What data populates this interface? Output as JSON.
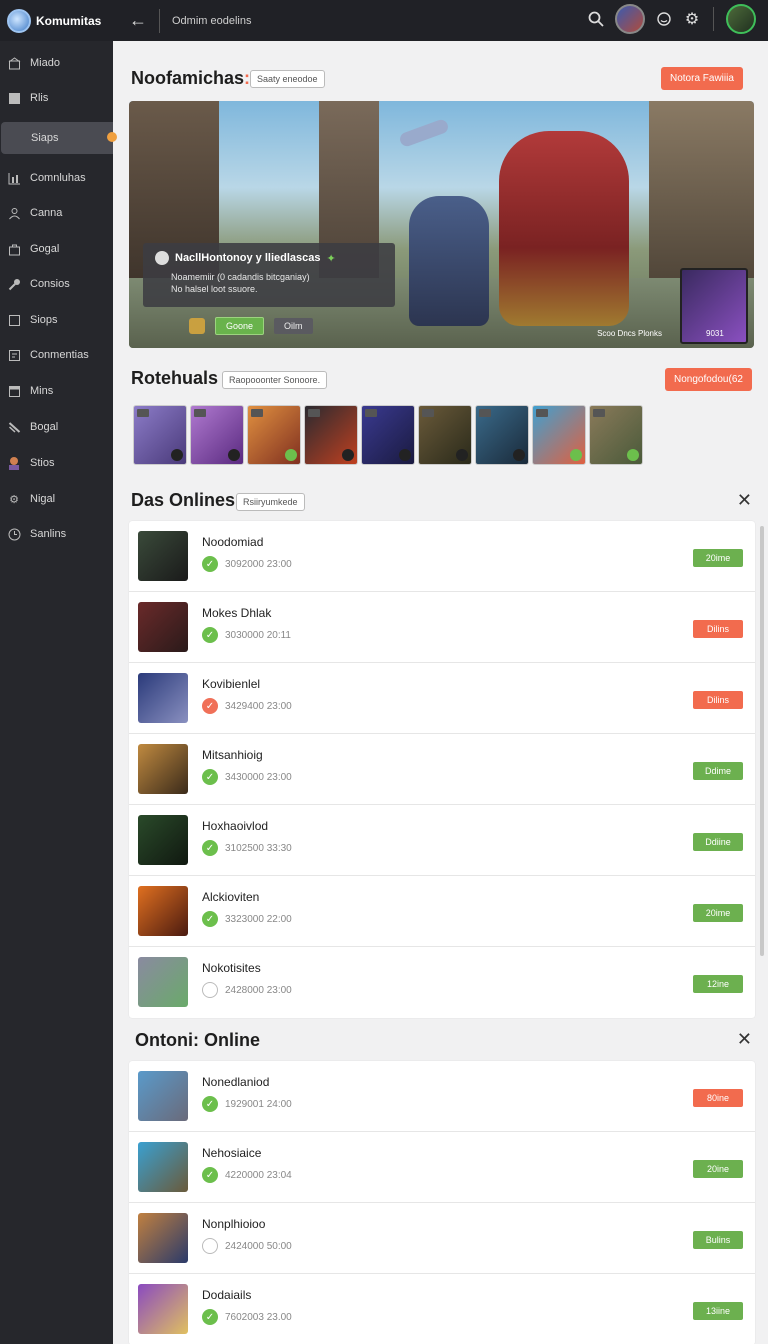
{
  "app": {
    "name": "Komumitas",
    "breadcrumb": "Odmim eodelins"
  },
  "sidebar": {
    "items": [
      {
        "label": "Miado",
        "icon": "home-icon"
      },
      {
        "label": "Rlis",
        "icon": "box-icon"
      },
      {
        "label": "Siaps",
        "icon": "flag-icon",
        "active": true
      },
      {
        "label": "Comnluhas",
        "icon": "chart-icon"
      },
      {
        "label": "Canna",
        "icon": "people-icon"
      },
      {
        "label": "Gogal",
        "icon": "bag-icon"
      },
      {
        "label": "Consios",
        "icon": "key-icon"
      },
      {
        "label": "Siops",
        "icon": "square-icon"
      },
      {
        "label": "Conmentias",
        "icon": "note-icon"
      },
      {
        "label": "Mins",
        "icon": "window-icon"
      },
      {
        "label": "Bogal",
        "icon": "tools-icon"
      },
      {
        "label": "Stios",
        "icon": "avatar-icon"
      },
      {
        "label": "Nigal",
        "icon": "gear-icon"
      },
      {
        "label": "Sanlins",
        "icon": "clock-icon"
      }
    ]
  },
  "featured": {
    "title": "Noofamichas",
    "chip": "Saaty eneodoe",
    "cta": "Notora Fawiiia",
    "hero": {
      "card_title": "NacllHontonoy y lliedlascas",
      "card_sub_1": "Noamemiir (0 cadandis bitcganiay)",
      "card_sub_2": "No halsel loot ssuore.",
      "btn_primary": "Goone",
      "btn_secondary": "Oilm",
      "caption": "Scoo Dncs Plonks",
      "thumb_label": "9031"
    }
  },
  "rotations": {
    "title": "Rotehuals",
    "chip": "Raopooonter Sonoore.",
    "cta": "Nongofodou(62",
    "thumbs": [
      {
        "colors": [
          "#8c7cc8",
          "#4a3a7a"
        ],
        "check": "dark"
      },
      {
        "colors": [
          "#b07ad0",
          "#5a2a80"
        ],
        "check": "dark"
      },
      {
        "colors": [
          "#e09040",
          "#803020"
        ],
        "check": "green"
      },
      {
        "colors": [
          "#2a2a30",
          "#c04020"
        ],
        "check": "dark"
      },
      {
        "colors": [
          "#3a3a90",
          "#1a1a40"
        ],
        "check": "dark"
      },
      {
        "colors": [
          "#6a5a3a",
          "#2a2a1a"
        ],
        "check": "dark"
      },
      {
        "colors": [
          "#3a6a8a",
          "#1a2a3a"
        ],
        "check": "dark"
      },
      {
        "colors": [
          "#40a0d0",
          "#e06040"
        ],
        "check": "green"
      },
      {
        "colors": [
          "#8a7a5a",
          "#4a5a3a"
        ],
        "check": "green"
      }
    ]
  },
  "das_onlines": {
    "title": "Das Onlines",
    "chip": "Rsiiryumkede",
    "rows": [
      {
        "name": "Noodomiad",
        "time": "3092000 23:00",
        "check": "green",
        "status": "20ime",
        "pill": "green",
        "avatar": [
          "#3a4a3a",
          "#1a1a1a"
        ]
      },
      {
        "name": "Mokes Dhlak",
        "time": "3030000 20:11",
        "check": "green",
        "status": "Dilins",
        "pill": "orange",
        "avatar": [
          "#6a2a2a",
          "#2a1a1a"
        ]
      },
      {
        "name": "Kovibienlel",
        "time": "3429400 23:00",
        "check": "red",
        "status": "Dilins",
        "pill": "orange",
        "avatar": [
          "#2a3a7a",
          "#8a90c0"
        ]
      },
      {
        "name": "Mitsanhioig",
        "time": "3430000 23:00",
        "check": "green",
        "status": "Ddime",
        "pill": "green",
        "avatar": [
          "#c08a40",
          "#3a2a1a"
        ]
      },
      {
        "name": "Hoxhaoivlod",
        "time": "3102500 33:30",
        "check": "green",
        "status": "Ddiine",
        "pill": "green",
        "avatar": [
          "#2a4a2a",
          "#101810"
        ]
      },
      {
        "name": "Alckioviten",
        "time": "3323000 22:00",
        "check": "green",
        "status": "20ime",
        "pill": "green",
        "avatar": [
          "#e07020",
          "#4a1a10"
        ]
      },
      {
        "name": "Nokotisites",
        "time": "2428000 23:00",
        "check": "empty",
        "status": "12ine",
        "pill": "green",
        "avatar": [
          "#8a8aa0",
          "#6aaa6a"
        ]
      }
    ]
  },
  "ontoni_online": {
    "title": "Ontoni: Online",
    "rows": [
      {
        "name": "Nonedlaniod",
        "time": "1929001 24:00",
        "check": "green",
        "status": "80ine",
        "pill": "orange",
        "avatar": [
          "#5a9aca",
          "#6a6a7a"
        ]
      },
      {
        "name": "Nehosiaice",
        "time": "4220000 23:04",
        "check": "green",
        "status": "20ine",
        "pill": "green",
        "avatar": [
          "#3aa0d0",
          "#6a5a3a"
        ]
      },
      {
        "name": "Nonplhioioo",
        "time": "2424000 50:00",
        "check": "empty",
        "status": "Bulins",
        "pill": "green",
        "avatar": [
          "#c08040",
          "#2a3a6a"
        ]
      },
      {
        "name": "Dodaiails",
        "time": "7602003 23.00",
        "check": "green",
        "status": "13iine",
        "pill": "green",
        "avatar": [
          "#8a4ac0",
          "#e0c060"
        ]
      }
    ]
  }
}
